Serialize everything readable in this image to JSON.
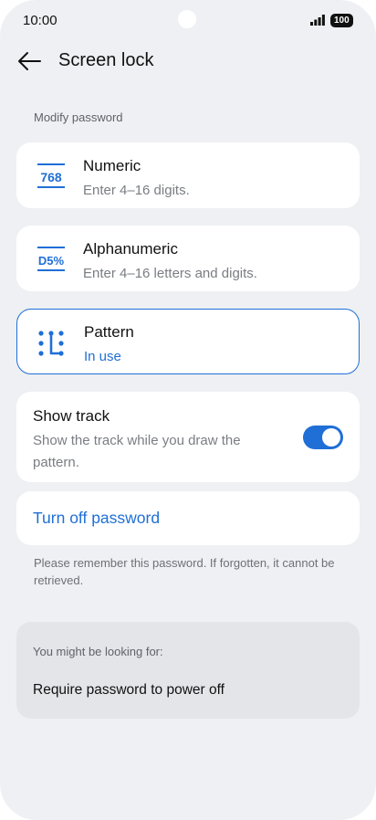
{
  "status_bar": {
    "time": "10:00",
    "battery": "100"
  },
  "header": {
    "title": "Screen lock"
  },
  "section": {
    "label": "Modify password"
  },
  "options": [
    {
      "icon": "numeric-icon",
      "icon_text": "768",
      "title": "Numeric",
      "subtitle": "Enter 4–16 digits.",
      "selected": false
    },
    {
      "icon": "alphanumeric-icon",
      "icon_text": "D5%",
      "title": "Alphanumeric",
      "subtitle": "Enter 4–16 letters and digits.",
      "selected": false
    },
    {
      "icon": "pattern-icon",
      "title": "Pattern",
      "subtitle": "In use",
      "selected": true
    }
  ],
  "show_track": {
    "title": "Show track",
    "description": "Show the track while you draw the pattern.",
    "enabled": true
  },
  "turn_off": {
    "label": "Turn off password"
  },
  "warning": "Please remember this password. If forgotten, it cannot be retrieved.",
  "suggestions": {
    "heading": "You might be looking for:",
    "items": [
      "Require password to power off"
    ]
  },
  "colors": {
    "accent": "#1f6fd6",
    "background": "#eef0f3",
    "card": "#ffffff"
  }
}
